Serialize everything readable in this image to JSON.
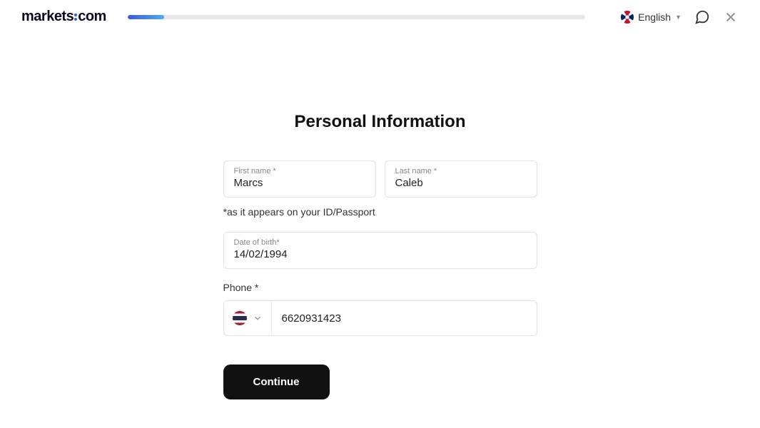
{
  "header": {
    "logo_part1": "markets",
    "logo_part2": "com",
    "language_label": "English"
  },
  "form": {
    "title": "Personal Information",
    "first_name_label": "First name *",
    "first_name_value": "Marcs",
    "last_name_label": "Last name *",
    "last_name_value": "Caleb",
    "id_helper": "*as it appears on your ID/Passport",
    "dob_label": "Date of birth*",
    "dob_value": "14/02/1994",
    "phone_label": "Phone *",
    "phone_value": "6620931423",
    "continue_label": "Continue"
  }
}
